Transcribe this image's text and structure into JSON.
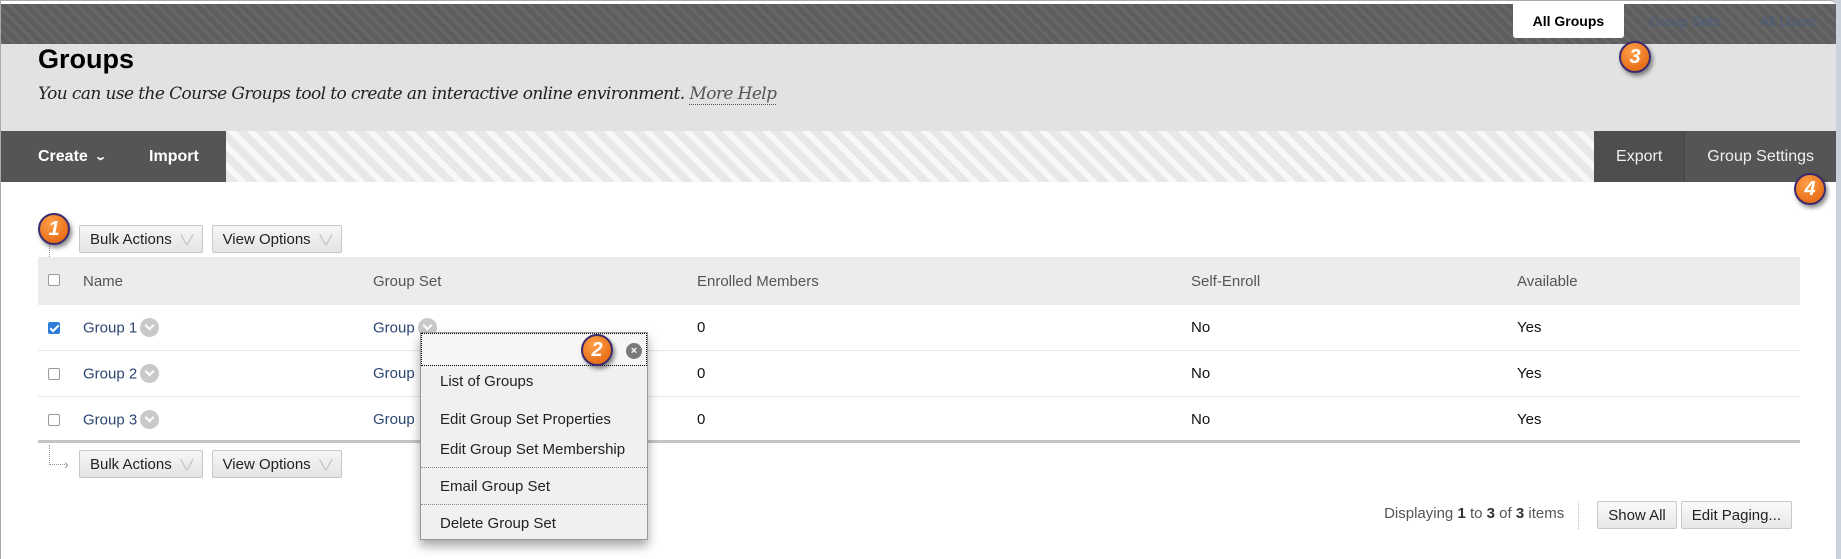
{
  "nav_tabs": [
    {
      "label": "All Groups",
      "active": true
    },
    {
      "label": "Group Sets",
      "active": false
    },
    {
      "label": "All Users",
      "active": false
    }
  ],
  "header": {
    "title": "Groups",
    "description": "You can use the Course Groups tool to create an interactive online environment.",
    "help_link": "More Help"
  },
  "action_bar": {
    "create_label": "Create",
    "import_label": "Import",
    "export_label": "Export",
    "group_settings_label": "Group Settings"
  },
  "toolbar": {
    "bulk_actions_label": "Bulk Actions",
    "view_options_label": "View Options"
  },
  "table": {
    "columns": [
      "Name",
      "Group Set",
      "Enrolled Members",
      "Self-Enroll",
      "Available"
    ],
    "rows": [
      {
        "checked": true,
        "name": "Group 1",
        "group_set": "Group",
        "enrolled": "0",
        "self_enroll": "No",
        "available": "Yes"
      },
      {
        "checked": false,
        "name": "Group 2",
        "group_set": "Group",
        "enrolled": "0",
        "self_enroll": "No",
        "available": "Yes"
      },
      {
        "checked": false,
        "name": "Group 3",
        "group_set": "Group",
        "enrolled": "0",
        "self_enroll": "No",
        "available": "Yes"
      }
    ]
  },
  "context_menu": {
    "close_icon": "×",
    "items": [
      "List of Groups",
      "Edit Group Set Properties",
      "Edit Group Set Membership",
      "Email Group Set",
      "Delete Group Set"
    ]
  },
  "paging": {
    "prefix": "Displaying",
    "from": "1",
    "to_word": "to",
    "to": "3",
    "of_word": "of",
    "total": "3",
    "suffix": "items",
    "show_all_label": "Show All",
    "edit_paging_label": "Edit Paging..."
  },
  "callouts": [
    "1",
    "2",
    "3",
    "4"
  ],
  "colors": {
    "accent_orange": "#e8711a",
    "link_blue": "#2d4671",
    "action_bar_dark": "#555555"
  }
}
